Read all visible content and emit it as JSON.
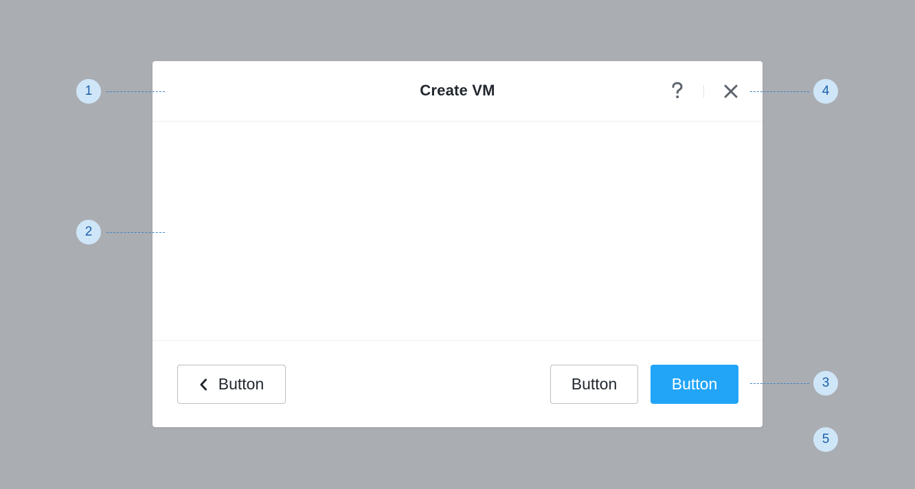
{
  "modal": {
    "title": "Create VM",
    "help_icon": "question-mark-icon",
    "close_icon": "close-x-icon"
  },
  "footer": {
    "back_label": "Button",
    "back_icon": "chevron-left-icon",
    "secondary_label": "Button",
    "primary_label": "Button"
  },
  "callouts": [
    "1",
    "2",
    "3",
    "4",
    "5"
  ],
  "colors": {
    "background": "#aaadb2",
    "modal_background": "#ffffff",
    "primary": "#22a5f7",
    "callout_fill": "#cfe6f8",
    "callout_text": "#1a5fa8",
    "leader_line": "#3b82c8",
    "icon": "#5d646d",
    "button_border": "#b8bdc3"
  }
}
